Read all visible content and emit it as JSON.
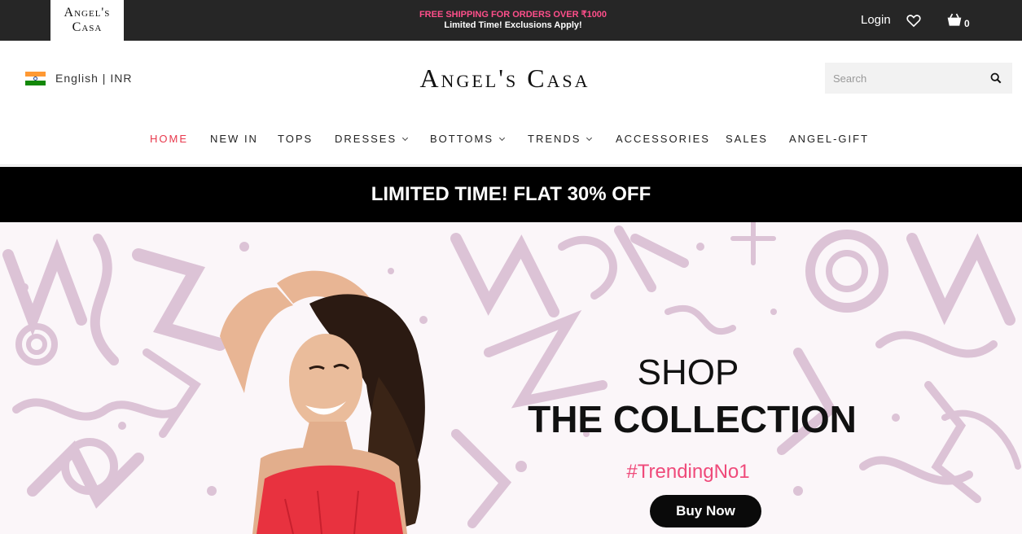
{
  "topbar": {
    "logo_line1": "Angel's",
    "logo_line2": "Casa",
    "promo_line1": "FREE SHIPPING FOR ORDERS OVER ₹1000",
    "promo_line2": "Limited Time! Exclusions Apply!",
    "login": "Login",
    "cart_count": "0",
    "icons": [
      "heart-icon",
      "cart-icon"
    ]
  },
  "header": {
    "language": "English | INR",
    "flag": "india-flag-icon",
    "logo": "Angel's Casa",
    "search_placeholder": "Search"
  },
  "nav": {
    "items": [
      {
        "label": "HOME",
        "active": true
      },
      {
        "label": "NEW IN"
      },
      {
        "label": "TOPS"
      },
      {
        "label": "DRESSES",
        "dropdown": true
      },
      {
        "label": "BOTTOMS",
        "dropdown": true
      },
      {
        "label": "TRENDS",
        "dropdown": true
      },
      {
        "label": "ACCESSORIES"
      },
      {
        "label": "SALES"
      },
      {
        "label": "ANGEL-GIFT"
      }
    ]
  },
  "announcement": "LIMITED TIME! FLAT 30% OFF",
  "hero": {
    "heading1": "SHOP",
    "heading2": "THE COLLECTION",
    "tag": "#TrendingNo1",
    "cta": "Buy Now"
  },
  "colors": {
    "topbar_bg": "#262626",
    "promo_pink": "#ff4f8b",
    "active_nav": "#e8394d",
    "hashtag": "#ef4a7a",
    "graffiti": "#dcc3d6"
  }
}
